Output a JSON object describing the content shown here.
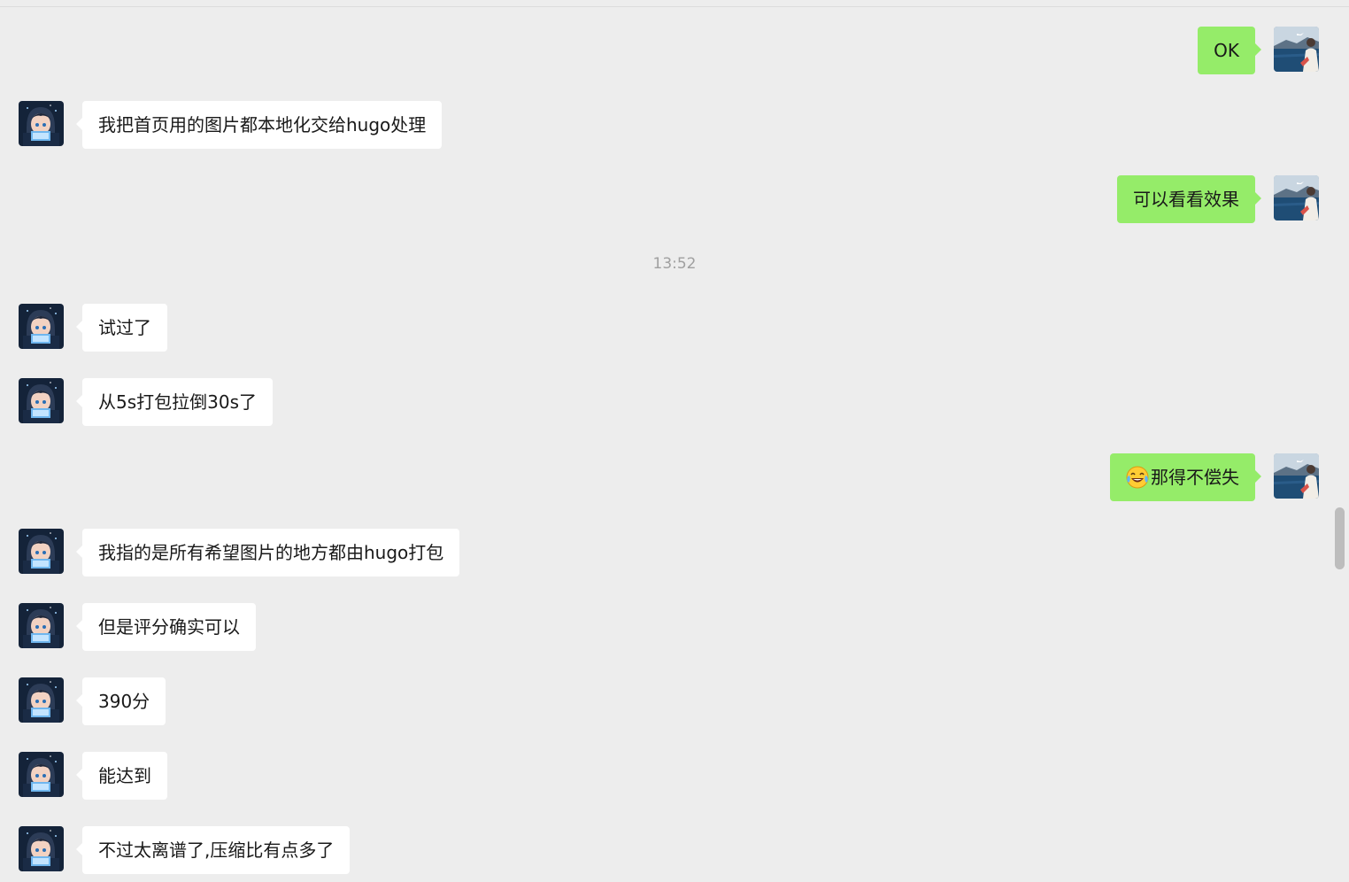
{
  "timestamp": "13:52",
  "messages": [
    {
      "side": "right",
      "text": "OK"
    },
    {
      "side": "left",
      "text": "我把首页用的图片都本地化交给hugo处理"
    },
    {
      "side": "right",
      "text": "可以看看效果"
    },
    {
      "side": "left",
      "text": "试过了"
    },
    {
      "side": "left",
      "text": "从5s打包拉倒30s了"
    },
    {
      "side": "right",
      "text": "那得不偿失",
      "emoji": "laugh-cry-emoji"
    },
    {
      "side": "left",
      "text": "我指的是所有希望图片的地方都由hugo打包"
    },
    {
      "side": "left",
      "text": "但是评分确实可以"
    },
    {
      "side": "left",
      "text": "390分"
    },
    {
      "side": "left",
      "text": "能达到"
    },
    {
      "side": "left",
      "text": "不过太离谱了,压缩比有点多了"
    }
  ],
  "colors": {
    "background": "#ededed",
    "sent_bubble": "#95ec69",
    "received_bubble": "#ffffff",
    "timestamp_text": "#a0a0a0"
  },
  "icons": {
    "sent_avatar": "seaside-avatar",
    "received_avatar": "anime-hooded-avatar",
    "emoji": "laugh-cry-emoji"
  }
}
